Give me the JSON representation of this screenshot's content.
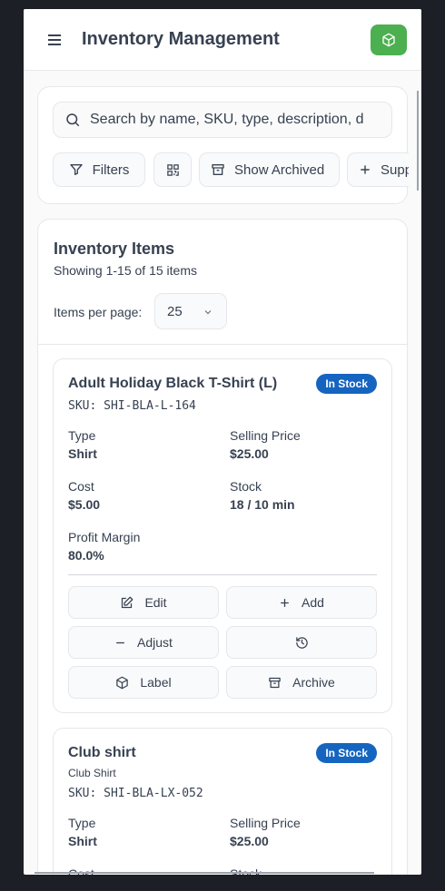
{
  "header": {
    "title": "Inventory Management",
    "menu_icon": "hamburger-icon",
    "logo_icon": "package-icon",
    "logo_color": "#4caf50"
  },
  "search": {
    "placeholder": "Search by name, SKU, type, description, d"
  },
  "toolbar": {
    "filters_label": "Filters",
    "archived_label": "Show Archived",
    "suppliers_label": "Suppli"
  },
  "inventory": {
    "title": "Inventory Items",
    "showing": "Showing 1-15 of 15 items",
    "per_page_label": "Items per page:",
    "per_page_value": "25"
  },
  "labels": {
    "type": "Type",
    "selling_price": "Selling Price",
    "cost": "Cost",
    "stock": "Stock",
    "profit_margin": "Profit Margin"
  },
  "actions": {
    "edit": "Edit",
    "add": "Add",
    "adjust": "Adjust",
    "label": "Label",
    "archive": "Archive"
  },
  "items": [
    {
      "name": "Adult Holiday Black T-Shirt (L)",
      "status": "In Stock",
      "sku": "SKU: SHI-BLA-L-164",
      "type": "Shirt",
      "selling_price": "$25.00",
      "cost": "$5.00",
      "stock": "18 / 10 min",
      "profit_margin": "80.0%"
    },
    {
      "name": "Club shirt",
      "description": "Club Shirt",
      "status": "In Stock",
      "sku": "SKU: SHI-BLA-LX-052",
      "type": "Shirt",
      "selling_price": "$25.00"
    }
  ],
  "colors": {
    "badge": "#1565c0",
    "background": "#1c1f26"
  }
}
